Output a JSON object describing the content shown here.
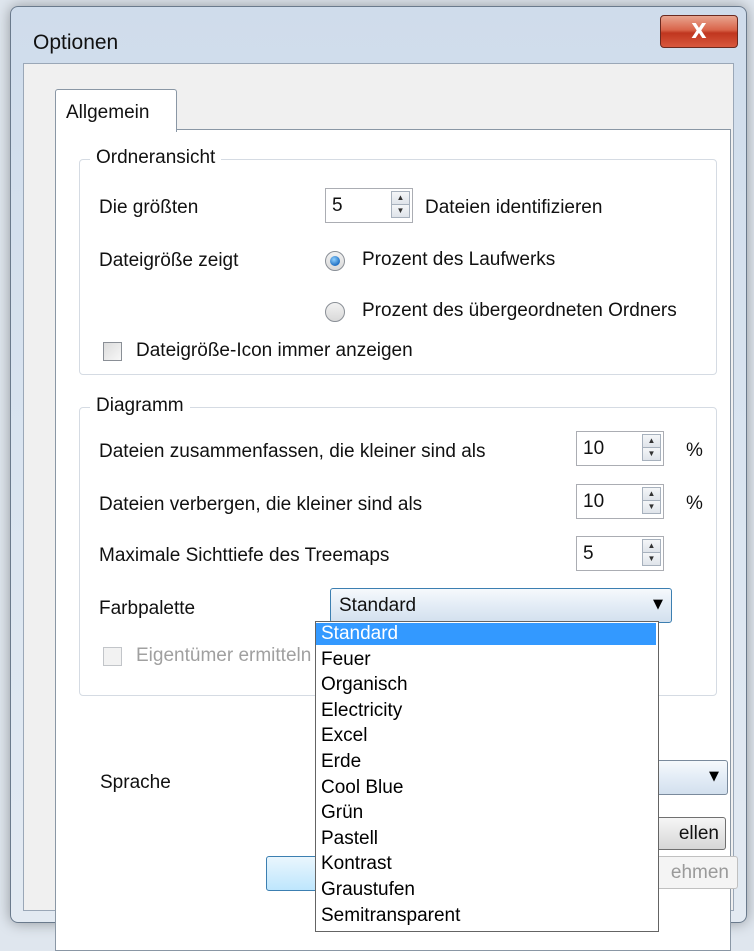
{
  "window": {
    "title": "Optionen",
    "close_glyph": "X"
  },
  "tabs": [
    {
      "label": "Allgemein"
    }
  ],
  "ordneransicht": {
    "group_title": "Ordneransicht",
    "largest_label": "Die größten",
    "largest_value": "5",
    "largest_suffix": "Dateien identifizieren",
    "filesize_label": "Dateigröße zeigt",
    "radio_drive": "Prozent des Laufwerks",
    "radio_parent": "Prozent des übergeordneten Ordners",
    "radio_selected": "drive",
    "always_icon_label": "Dateigröße-Icon immer anzeigen",
    "always_icon_checked": false
  },
  "diagramm": {
    "group_title": "Diagramm",
    "combine_label": "Dateien zusammenfassen, die kleiner sind als",
    "combine_value": "10",
    "combine_unit": "%",
    "hide_label": "Dateien verbergen, die kleiner sind als",
    "hide_value": "10",
    "hide_unit": "%",
    "depth_label": "Maximale Sichttiefe des Treemaps",
    "depth_value": "5",
    "palette_label": "Farbpalette",
    "palette_value": "Standard",
    "owner_label": "Eigentümer ermitteln",
    "owner_enabled": false
  },
  "palette_options": [
    "Standard",
    "Feuer",
    "Organisch",
    "Electricity",
    "Excel",
    "Erde",
    "Cool Blue",
    "Grün",
    "Pastell",
    "Kontrast",
    "Graustufen",
    "Semitransparent"
  ],
  "palette_selected_index": 0,
  "sprache": {
    "label": "Sprache",
    "reset_button_visible_text": "ellen"
  },
  "footer": {
    "apply_visible_text": "ehmen"
  },
  "icons": {
    "spin_up": "▲",
    "spin_down": "▼",
    "dropdown_arrow": "▼"
  }
}
